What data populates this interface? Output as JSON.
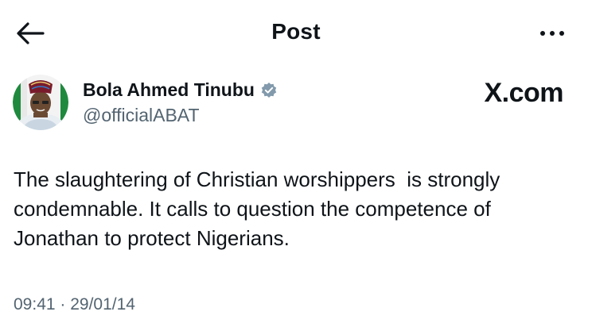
{
  "header": {
    "back_icon": "arrow-left-icon",
    "title": "Post",
    "more_icon": "more-horizontal-icon"
  },
  "author": {
    "display_name": "Bola Ahmed Tinubu",
    "handle": "@officialABAT",
    "verified_icon": "verified-badge-icon",
    "verified_color": "#829aab"
  },
  "watermark": "X.com",
  "tweet": {
    "text": "The slaughtering of Christian worshippers  is strongly\ncondemnable. It calls to question the competence of\nJonathan to protect Nigerians.",
    "timestamp": "09:41 · 29/01/14"
  },
  "colors": {
    "text_primary": "#0f1419",
    "text_secondary": "#536471",
    "background": "#ffffff"
  }
}
